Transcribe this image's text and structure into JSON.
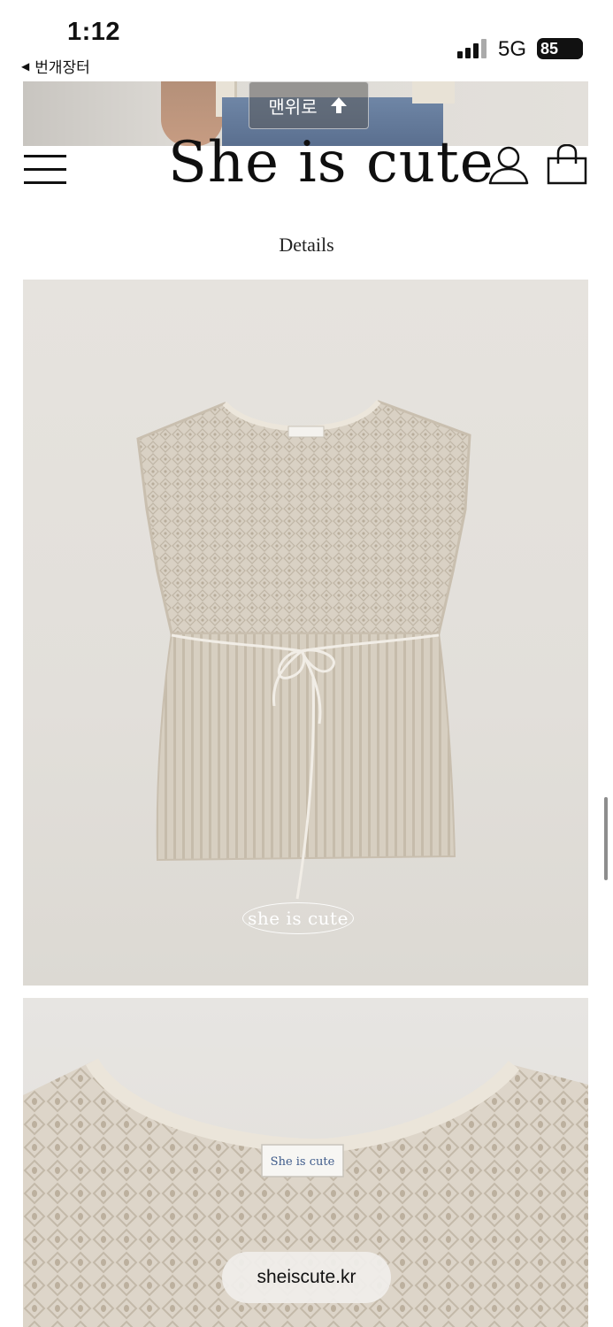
{
  "status_bar": {
    "time": "1:12",
    "back_app_label": "번개장터",
    "network": "5G",
    "battery": "85"
  },
  "top_button": {
    "label": "맨위로",
    "icon": "arrow-up-icon"
  },
  "header": {
    "logo": "She is cute",
    "menu_icon": "hamburger-menu-icon",
    "user_icon": "user-icon",
    "cart_icon": "shopping-bag-icon"
  },
  "section": {
    "title": "Details"
  },
  "photo1": {
    "watermark": "she is cute",
    "neck_label": "She is cute"
  },
  "photo2": {
    "neck_label": "She is cute"
  },
  "url_pill": {
    "text": "sheiscute.kr"
  },
  "colors": {
    "background": "#ffffff",
    "knit": "#d8d0c3",
    "wall": "#e4e1dc"
  }
}
